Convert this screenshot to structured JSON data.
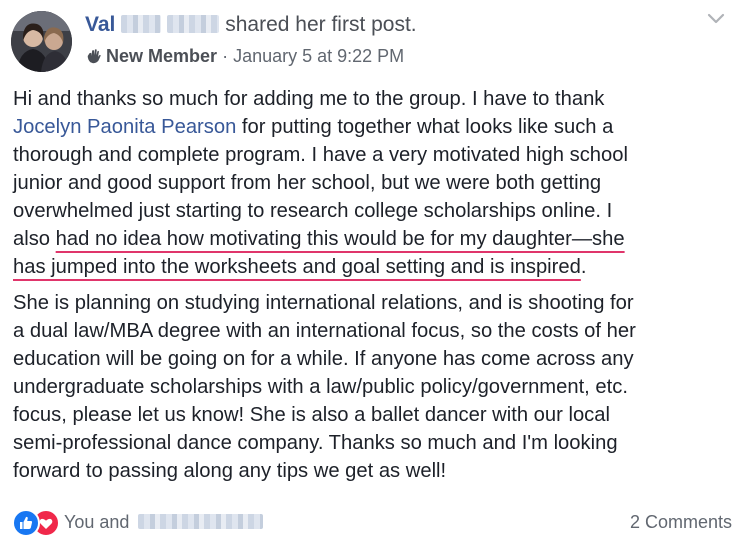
{
  "post": {
    "author_visible": "Val",
    "action": "shared her first post.",
    "badge": "New Member",
    "separator": "·",
    "timestamp": "January 5 at 9:22 PM",
    "body": {
      "p1_l1": "Hi and thanks so much for adding me to the group. I have to thank",
      "mention": "Jocelyn Paonita Pearson",
      "p1_l2_rest": " for putting together what looks like such a",
      "p1_l3": "thorough and complete program. I have a very motivated high school",
      "p1_l4": "junior and good support from her school, but we were both getting",
      "p1_l5": "overwhelmed just starting to research college scholarships online. I",
      "p1_l6_pre": "also ",
      "p1_l6_ul": "had no idea how motivating this would be for my daughter—she",
      "p1_l7_ul": "has jumped into the worksheets and goal setting and is inspired",
      "p1_l7_end": ".",
      "p2_l1": "She is planning on studying international relations, and is shooting for",
      "p2_l2": "a dual law/MBA degree with an international focus, so the costs of her",
      "p2_l3": "education will be going on for a while. If anyone has come across any",
      "p2_l4": "undergraduate scholarships with a law/public policy/government, etc.",
      "p2_l5": "focus, please let us know! She is also a ballet dancer with our local",
      "p2_l6": "semi-professional dance company. Thanks so much and I'm looking",
      "p2_l7": "forward to passing along any tips we get as well!"
    }
  },
  "footer": {
    "reactors_prefix": "You and",
    "comments": "2 Comments"
  },
  "colors": {
    "link": "#385898",
    "underline": "#e0356b",
    "like": "#1877f2",
    "love": "#f0284a"
  },
  "icons": {
    "badge": "waving-hand-icon",
    "menu": "chevron-down-icon",
    "like": "thumbs-up-icon",
    "love": "heart-icon"
  }
}
